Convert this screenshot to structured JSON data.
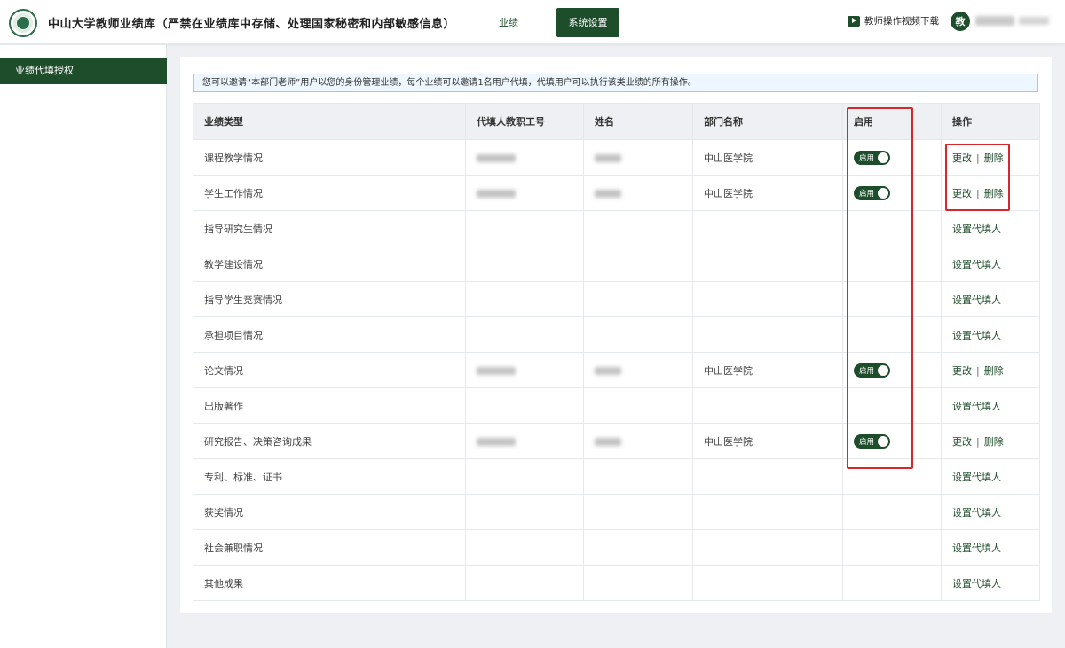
{
  "header": {
    "title": "中山大学教师业绩库（严禁在业绩库中存储、处理国家秘密和内部敏感信息）",
    "nav": {
      "performance": "业绩",
      "settings": "系统设置"
    },
    "video_link": "教师操作视频下载",
    "avatar_char": "教"
  },
  "sidebar": {
    "items": [
      {
        "label": "业绩代填授权"
      }
    ]
  },
  "notice": "您可以邀请“本部门老师”用户以您的身份管理业绩，每个业绩可以邀请1名用户代填，代填用户可以执行该类业绩的所有操作。",
  "table": {
    "columns": [
      "业绩类型",
      "代填人教职工号",
      "姓名",
      "部门名称",
      "启用",
      "操作"
    ],
    "toggle_label": "启用",
    "edit_label": "更改",
    "separator": "|",
    "delete_label": "删除",
    "set_label": "设置代填人",
    "rows": [
      {
        "type": "课程教学情况",
        "dept": "中山医学院"
      },
      {
        "type": "学生工作情况",
        "dept": "中山医学院"
      },
      {
        "type": "指导研究生情况",
        "dept": ""
      },
      {
        "type": "教学建设情况",
        "dept": ""
      },
      {
        "type": "指导学生竞赛情况",
        "dept": ""
      },
      {
        "type": "承担项目情况",
        "dept": ""
      },
      {
        "type": "论文情况",
        "dept": "中山医学院"
      },
      {
        "type": "出版著作",
        "dept": ""
      },
      {
        "type": "研究报告、决策咨询成果",
        "dept": "中山医学院"
      },
      {
        "type": "专利、标准、证书",
        "dept": ""
      },
      {
        "type": "获奖情况",
        "dept": ""
      },
      {
        "type": "社会兼职情况",
        "dept": ""
      },
      {
        "type": "其他成果",
        "dept": ""
      }
    ]
  },
  "colors": {
    "brand_green": "#1e4d2b",
    "annotation_red": "#d8272a",
    "notice_bg": "#eef7ff"
  }
}
